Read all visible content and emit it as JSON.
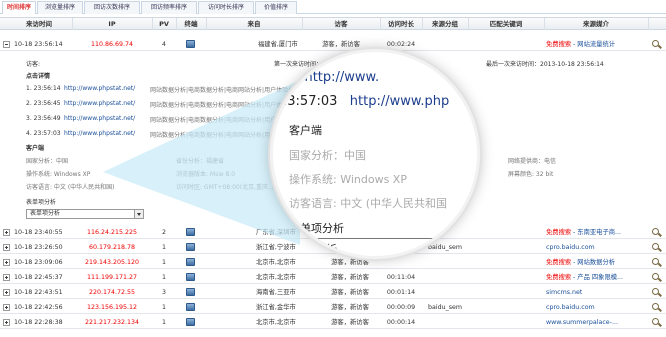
{
  "tabs": [
    "时间排序",
    "浏览量排序",
    "回访次数排序",
    "回访频率排序",
    "访问时长排序",
    "价值排序"
  ],
  "columns": [
    "来访时间",
    "IP",
    "PV",
    "终端",
    "来自",
    "访客",
    "访问时长",
    "来源分组",
    "匹配关键词",
    "来源媒介"
  ],
  "expanded_row": {
    "time": "10-18 23:56:14",
    "ip": "110.86.69.74",
    "pv": "4",
    "from": "福建省,厦门市",
    "visitor": "游客，新访客",
    "duration": "00:02:24",
    "group": "",
    "keyword": "",
    "source_red": "免费搜索",
    "source_rest": " - 网站流量统计"
  },
  "detail": {
    "visitor_label": "访客:",
    "first_visit": "第一次来访时间：2013-10-18 23:56:14",
    "last_visit": "最后一次来访时间：2013-10-18 23:56:14",
    "click_details_label": "点击详情",
    "clicks": [
      {
        "time": "1. 23:56:14",
        "url": "http://www.phpstat.net/",
        "title": "网站数据分析|电商数据分析|电商网站分析|用户体验分析"
      },
      {
        "time": "2. 23:56:45",
        "url": "http://www.phpstat.net/",
        "title": "网站数据分析|电商数据分析|电商网站分析|用户体验"
      },
      {
        "time": "3. 23:56:49",
        "url": "http://www.phpstat.net/",
        "title": "网站数据分析|电商数据分析|电商网站分析|用户体验"
      },
      {
        "time": "4. 23:57:03",
        "url": "http://www.phpstat.net/",
        "title": "网站数据分析|电商数据分析|电商网站分析|用户体验"
      }
    ],
    "client_label": "客户端",
    "country": "国家分析：中国",
    "province": "省份分析：福建省",
    "isp": "网络提供商：电信",
    "os": "操作系统: Windows XP",
    "browser": "浏览器版本: Msie 8.0",
    "color": "屏幕颜色: 32 bit",
    "lang": "访客语言: 中文 (中华人民共和国)",
    "tz": "访问时区: GMT+08:00(北京,重庆...)",
    "form_label": "表单项分析",
    "form_select_value": "表单项分析"
  },
  "lens": {
    "line1_time": ":49",
    "line1_url": "http://www.",
    "line2_time": "23:57:03",
    "line2_url": "http://www.php",
    "client": "客户端",
    "country": "国家分析：中国",
    "os": "操作系统: Windows XP",
    "lang": "访客语言: 中文 (中华人民共和国",
    "form": "表单项分析",
    "select": "单项分析"
  },
  "rows": [
    {
      "time": "10-18 23:40:55",
      "ip": "116.24.215.225",
      "pv": "2",
      "from": "广东省,深圳市",
      "visitor": "游客，新访客",
      "duration": "",
      "group": "",
      "source": "免费搜索",
      "source_rest": " - 东南亚电子商...",
      "src_red": true
    },
    {
      "time": "10-18 23:26:50",
      "ip": "60.179.218.78",
      "pv": "1",
      "from": "浙江省,宁波市",
      "visitor": "游客，新访客",
      "duration": "",
      "group": "baidu_sem",
      "source": "cpro.baidu.com",
      "source_rest": "",
      "src_red": false
    },
    {
      "time": "10-18 23:09:06",
      "ip": "219.143.205.120",
      "pv": "1",
      "from": "北京市,北京市",
      "visitor": "游客，新访客",
      "duration": "",
      "group": "",
      "source": "免费搜索",
      "source_rest": " - 网站数据分析",
      "src_red": true
    },
    {
      "time": "10-18 22:45:37",
      "ip": "111.199.171.27",
      "pv": "1",
      "from": "北京市,北京市",
      "visitor": "游客，新访客",
      "duration": "00:11:04",
      "group": "",
      "source": "免费搜索",
      "source_rest": " - 产品 四象限模...",
      "src_red": true
    },
    {
      "time": "10-18 22:43:51",
      "ip": "220.174.72.55",
      "pv": "3",
      "from": "海南省,三亚市",
      "visitor": "游客，新访客",
      "duration": "00:01:14",
      "group": "",
      "source": "simcms.net",
      "source_rest": "",
      "src_red": false
    },
    {
      "time": "10-18 22:42:56",
      "ip": "123.156.195.12",
      "pv": "1",
      "from": "浙江省,金华市",
      "visitor": "游客，新访客",
      "duration": "00:00:09",
      "group": "baidu_sem",
      "source": "cpro.baidu.com",
      "source_rest": "",
      "src_red": false
    },
    {
      "time": "10-18 22:28:38",
      "ip": "221.217.232.134",
      "pv": "1",
      "from": "北京市,北京市",
      "visitor": "游客，新访客",
      "duration": "00:00:14",
      "group": "",
      "source": "www.summerpalace-...",
      "source_rest": "",
      "src_red": false
    }
  ]
}
